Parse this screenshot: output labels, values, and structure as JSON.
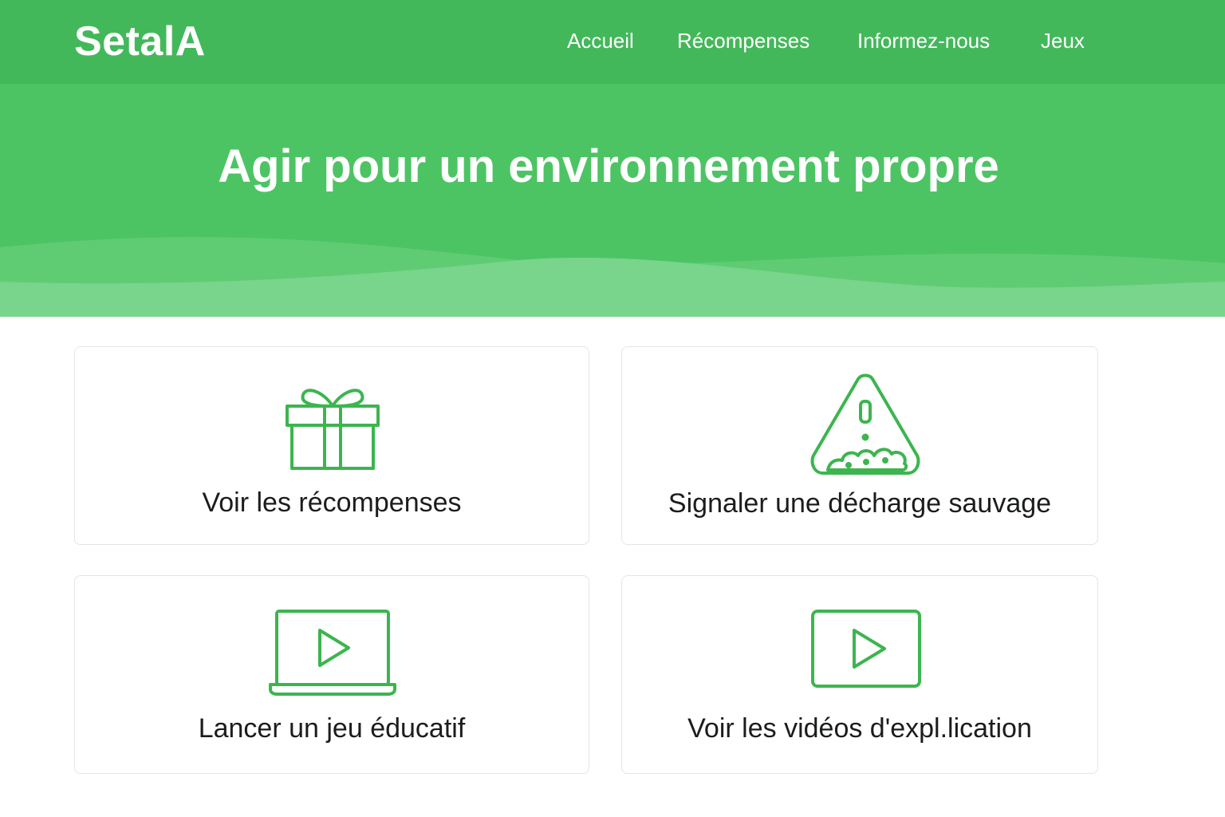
{
  "header": {
    "logo": "SetalA",
    "nav": [
      {
        "label": "Accueil"
      },
      {
        "label": "Récompenses"
      },
      {
        "label": "Informez-nous"
      },
      {
        "label": "Jeux"
      }
    ]
  },
  "hero": {
    "title": "Agir pour un environnement propre"
  },
  "cards": [
    {
      "label": "Voir les récompenses",
      "icon": "gift-icon"
    },
    {
      "label": "Signaler une décharge sauvage",
      "icon": "warning-trash-icon"
    },
    {
      "label": "Lancer un jeu éducatif",
      "icon": "laptop-play-icon"
    },
    {
      "label": "Voir les vidéos d'expl.lication",
      "icon": "video-play-icon"
    }
  ],
  "colors": {
    "header_green": "#43b85a",
    "hero_green": "#4dc464",
    "icon_green": "#3cb54f",
    "text_dark": "#1b1d1c"
  }
}
